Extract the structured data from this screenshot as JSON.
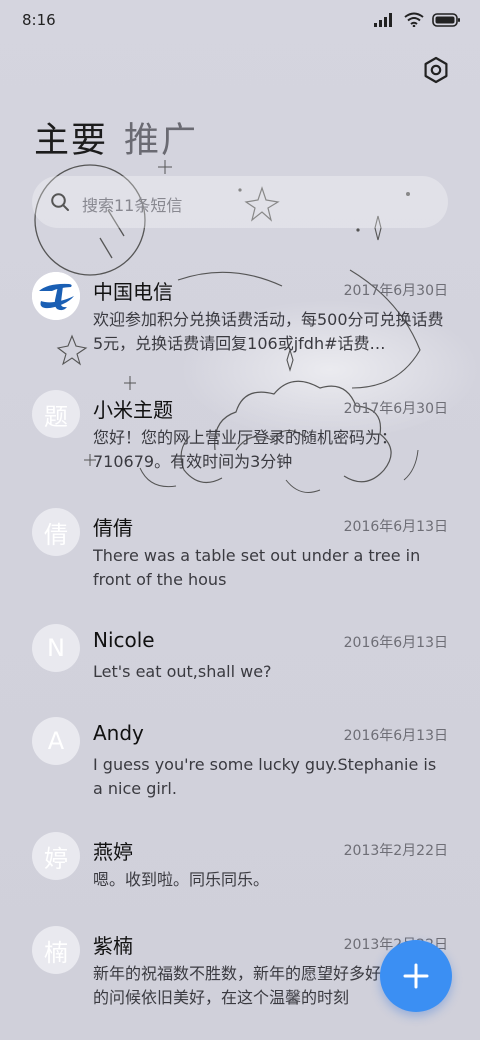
{
  "status_bar": {
    "time": "8:16",
    "icons": [
      "signal-icon",
      "wifi-icon",
      "battery-icon"
    ]
  },
  "tabs": [
    {
      "label": "主要",
      "active": true
    },
    {
      "label": "推广",
      "active": false
    }
  ],
  "search": {
    "placeholder": "搜索11条短信"
  },
  "messages": [
    {
      "avatar": "telecom-logo",
      "name": "中国电信",
      "date": "2017年6月30日",
      "preview": "欢迎参加积分兑换话费活动，每500分可兑换话费5元，兑换话费请回复106或jfdh#话费…"
    },
    {
      "avatar": "题",
      "name": "小米主题",
      "date": "2017年6月30日",
      "preview": "您好！您的网上营业厅登录的随机密码为：710679。有效时间为3分钟"
    },
    {
      "avatar": "倩",
      "name": "倩倩",
      "date": "2016年6月13日",
      "preview": "There was a table set out under a tree in front of the hous"
    },
    {
      "avatar": "N",
      "name": "Nicole",
      "date": "2016年6月13日",
      "preview": "Let's eat out,shall we?"
    },
    {
      "avatar": "A",
      "name": "Andy",
      "date": "2016年6月13日",
      "preview": "I guess you're some lucky guy.Stephanie is a nice girl."
    },
    {
      "avatar": "婷",
      "name": "燕婷",
      "date": "2013年2月22日",
      "preview": "嗯。收到啦。同乐同乐。"
    },
    {
      "avatar": "楠",
      "name": "紫楠",
      "date": "2013年2月22日",
      "preview": "新年的祝福数不胜数，新年的愿望好多好多，新年的问候依旧美好，在这个温馨的时刻"
    }
  ],
  "colors": {
    "fab": "#3b8ff3",
    "telecom": "#1a5fb4"
  }
}
